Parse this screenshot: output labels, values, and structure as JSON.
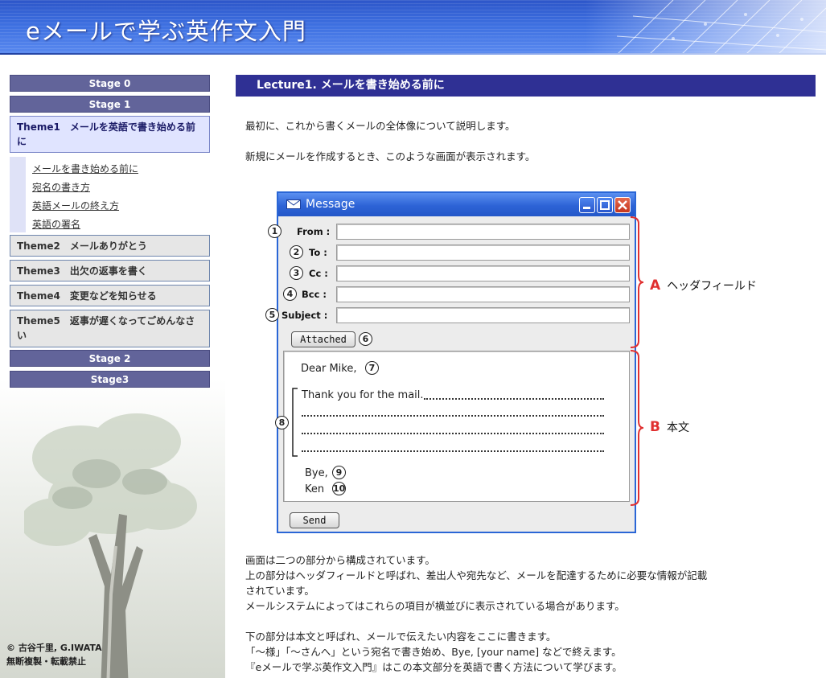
{
  "header": {
    "title": "eメールで学ぶ英作文入門"
  },
  "sidebar": {
    "stage0": "Stage 0",
    "stage1": "Stage 1",
    "theme1": "Theme1　メールを英語で書き始める前に",
    "sub_items": [
      "メールを書き始める前に",
      "宛名の書き方",
      "英語メールの終え方",
      "英語の署名"
    ],
    "theme2": "Theme2　メールありがとう",
    "theme3": "Theme3　出欠の返事を書く",
    "theme4": "Theme4　変更などを知らせる",
    "theme5": "Theme5　返事が遅くなってごめんなさい",
    "stage2": "Stage 2",
    "stage3": "Stage3",
    "copyright_line1": "© 古谷千里, G.IWATA",
    "copyright_line2": "無断複製・転載禁止"
  },
  "main": {
    "lecture_title": "Lecture1. メールを書き始める前に",
    "intro1": "最初に、これから書くメールの全体像について説明します。",
    "intro2": "新規にメールを作成するとき、このような画面が表示されます。",
    "after1": "画面は二つの部分から構成されています。",
    "after2": "上の部分はヘッダフィールドと呼ばれ、差出人や宛先など、メールを配達するために必要な情報が記載",
    "after3": "されています。",
    "after4": "メールシステムによってはこれらの項目が横並びに表示されている場合があります。",
    "after5": "下の部分は本文と呼ばれ、メールで伝えたい内容をここに書きます。",
    "after6": "「～様」「～さんへ」という宛名で書き始め、Bye, [your name] などで終えます。",
    "after7": "『eメールで学ぶ英作文入門』はこの本文部分を英語で書く方法について学びます。"
  },
  "message_window": {
    "title": "Message",
    "fields": [
      {
        "num": "1",
        "label": "From :"
      },
      {
        "num": "2",
        "label": "To :"
      },
      {
        "num": "3",
        "label": "Cc :"
      },
      {
        "num": "4",
        "label": "Bcc :"
      },
      {
        "num": "5",
        "label": "Subject :"
      }
    ],
    "attached_label": "Attached",
    "attached_num": "6",
    "greeting": "Dear Mike,",
    "greeting_num": "7",
    "body_line": "Thank you for the mail.",
    "body_num": "8",
    "closing": "Bye,",
    "closing_num": "9",
    "signature": "Ken",
    "signature_num": "10",
    "send_label": "Send"
  },
  "annotations": {
    "a_letter": "A",
    "a_text": "ヘッダフィールド",
    "b_letter": "B",
    "b_text": "本文"
  },
  "colors": {
    "header_blue": "#3d6fe0",
    "stage_bar": "#62649a",
    "lecture_bar": "#2f3094",
    "brace_red": "#e03030",
    "window_blue": "#2a66d6"
  }
}
